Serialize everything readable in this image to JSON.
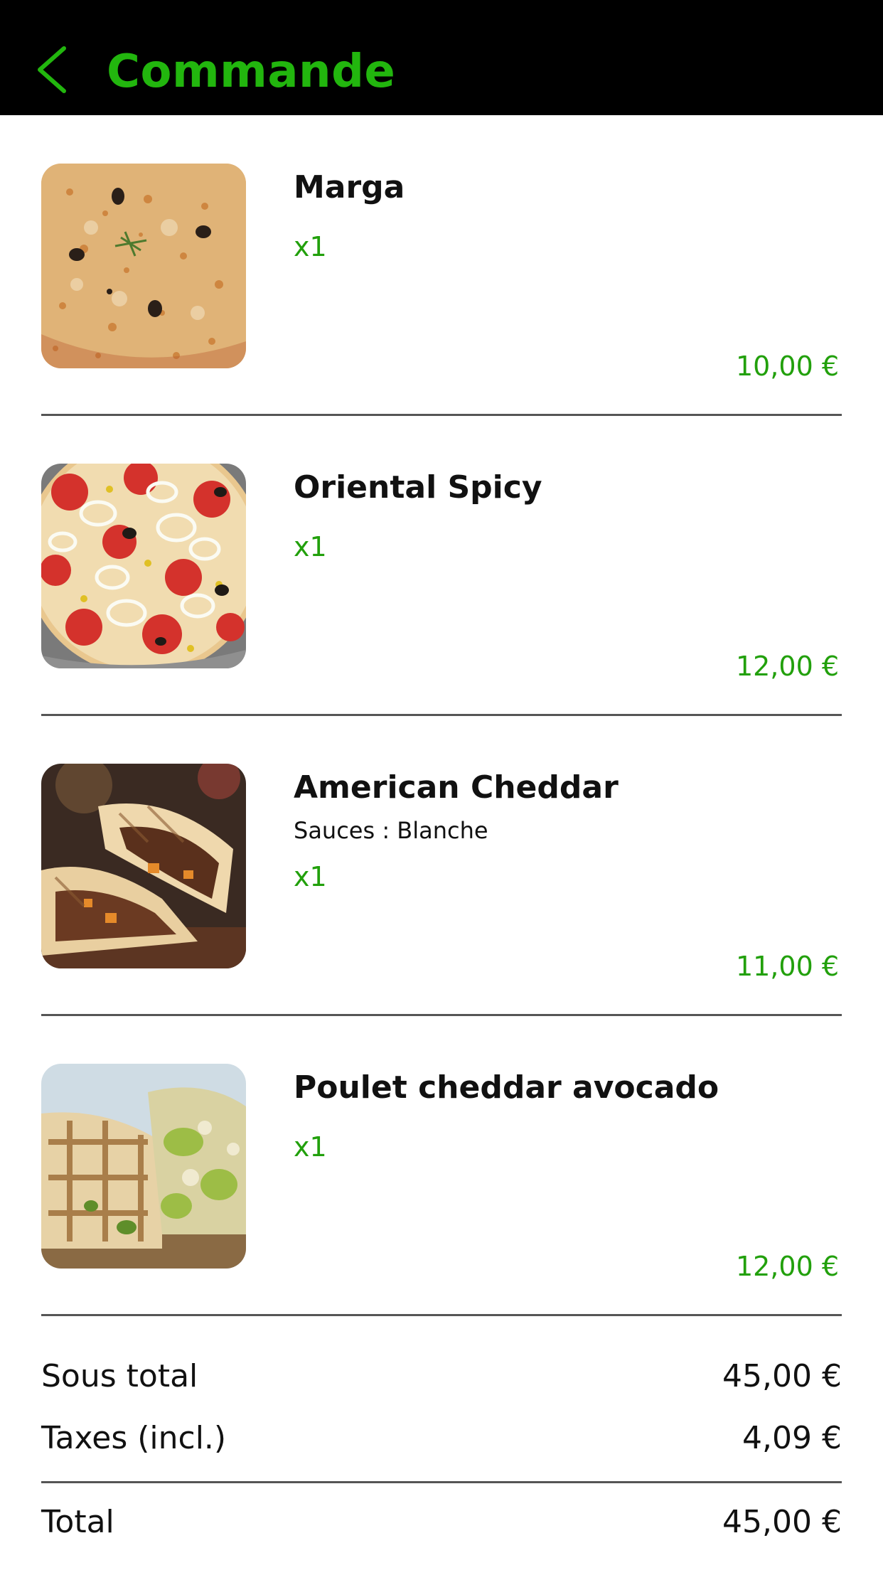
{
  "header": {
    "title": "Commande",
    "back_icon": "chevron-left-icon",
    "accent_color": "#22b60e",
    "background": "#000000"
  },
  "items": [
    {
      "name": "Marga",
      "options": "",
      "quantity": "x1",
      "price": "10,00 €",
      "image": "pizza-marga-image"
    },
    {
      "name": "Oriental Spicy",
      "options": "",
      "quantity": "x1",
      "price": "12,00 €",
      "image": "pizza-oriental-spicy-image"
    },
    {
      "name": "American Cheddar",
      "options": "Sauces : Blanche",
      "quantity": "x1",
      "price": "11,00 €",
      "image": "wrap-american-cheddar-image"
    },
    {
      "name": "Poulet cheddar avocado",
      "options": "",
      "quantity": "x1",
      "price": "12,00 €",
      "image": "wrap-poulet-cheddar-avocado-image"
    }
  ],
  "summary": {
    "subtotal_label": "Sous total",
    "subtotal_value": "45,00 €",
    "taxes_label": "Taxes (incl.)",
    "taxes_value": "4,09 €",
    "total_label": "Total",
    "total_value": "45,00 €"
  },
  "colors": {
    "price": "#22a00c",
    "divider": "#555555"
  }
}
